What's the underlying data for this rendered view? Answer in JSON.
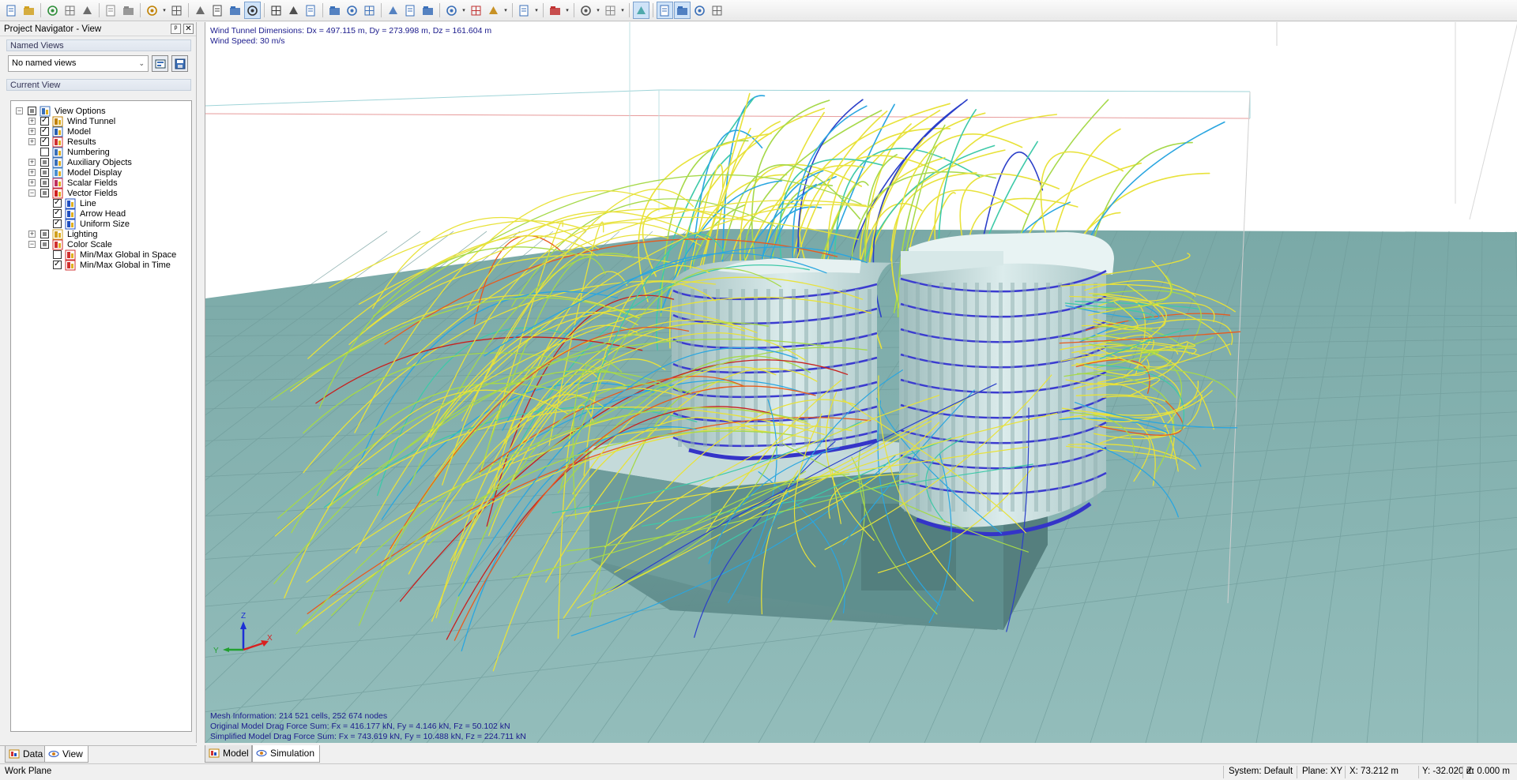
{
  "toolbar": {
    "icons": [
      "new-file-icon",
      "open-folder-icon",
      "save-icon",
      "print-preview-icon",
      "print-icon",
      "undo-icon",
      "redo-icon",
      "edit-menu-icon",
      "display-icon",
      "hide-icon",
      "grid-icon",
      "table-icon",
      "render-icon",
      "pan-icon",
      "rotate-icon",
      "fit-view-icon",
      "view-front-icon",
      "view-top-icon",
      "view-side-icon",
      "rotate-left-icon",
      "rotate-right-icon",
      "refresh-icon",
      "zoom-window-icon",
      "select-icon",
      "arrow-icon",
      "box-view-icon",
      "color-scale-icon",
      "section-icon",
      "wind-icon",
      "layers-icon",
      "panel-1-icon",
      "panel-2-icon",
      "panel-3-icon",
      "options-icon"
    ]
  },
  "navigator": {
    "title": "Project Navigator - View",
    "pin_label": "ᵖ",
    "close_label": "✕",
    "named_views_label": "Named Views",
    "named_views_value": "No named views",
    "current_view_label": "Current View",
    "tree": [
      {
        "label": "View Options",
        "level": 0,
        "expand": "minus",
        "check": "partial",
        "icon": "view-options-icon"
      },
      {
        "label": "Wind Tunnel",
        "level": 1,
        "expand": "plus",
        "check": "checked",
        "icon": "wind-tunnel-icon"
      },
      {
        "label": "Model",
        "level": 1,
        "expand": "plus",
        "check": "checked",
        "icon": "model-icon"
      },
      {
        "label": "Results",
        "level": 1,
        "expand": "plus",
        "check": "checked",
        "icon": "results-icon"
      },
      {
        "label": "Numbering",
        "level": 1,
        "expand": "none",
        "check": "unchecked",
        "icon": "numbering-icon"
      },
      {
        "label": "Auxiliary Objects",
        "level": 1,
        "expand": "plus",
        "check": "partial",
        "icon": "auxiliary-objects-icon"
      },
      {
        "label": "Model Display",
        "level": 1,
        "expand": "plus",
        "check": "partial",
        "icon": "model-display-icon"
      },
      {
        "label": "Scalar Fields",
        "level": 1,
        "expand": "plus",
        "check": "partial",
        "icon": "scalar-fields-icon"
      },
      {
        "label": "Vector Fields",
        "level": 1,
        "expand": "minus",
        "check": "partial",
        "icon": "vector-fields-icon"
      },
      {
        "label": "Line",
        "level": 2,
        "expand": "none",
        "check": "checked",
        "icon": "vector-line-icon"
      },
      {
        "label": "Arrow Head",
        "level": 2,
        "expand": "none",
        "check": "checked",
        "icon": "arrow-head-icon"
      },
      {
        "label": "Uniform Size",
        "level": 2,
        "expand": "none",
        "check": "checked",
        "icon": "uniform-size-icon"
      },
      {
        "label": "Lighting",
        "level": 1,
        "expand": "plus",
        "check": "partial",
        "icon": "lighting-icon"
      },
      {
        "label": "Color Scale",
        "level": 1,
        "expand": "minus",
        "check": "partial",
        "icon": "color-scale-icon"
      },
      {
        "label": "Min/Max Global in Space",
        "level": 2,
        "expand": "none",
        "check": "unchecked",
        "icon": "minmax-space-icon"
      },
      {
        "label": "Min/Max Global in Time",
        "level": 2,
        "expand": "none",
        "check": "checked",
        "icon": "minmax-time-icon"
      }
    ],
    "tabs": [
      {
        "label": "Data",
        "active": false
      },
      {
        "label": "View",
        "active": true
      }
    ]
  },
  "viewport": {
    "info_line1": "Wind Tunnel Dimensions: Dx = 497.115 m, Dy = 273.998 m, Dz = 161.604 m",
    "info_line2": "Wind Speed: 30 m/s",
    "mesh_info": "Mesh Information: 214 521 cells, 252 674 nodes",
    "original_drag": "Original Model Drag Force Sum: Fx = 416.177 kN, Fy = 4.146 kN, Fz = 50.102 kN",
    "simplified_drag": "Simplified Model Drag Force Sum: Fx = 743.619 kN, Fy = 10.488 kN, Fz = 224.711 kN",
    "axis_labels": {
      "z": "Z",
      "x": "X",
      "y": "Y"
    },
    "colors": {
      "ground": "#8ab5b3",
      "building": "#cfe3e3",
      "floor_bands": "#3b3bd0"
    },
    "streamline_palette": [
      "#e8e23a",
      "#a6d94a",
      "#3ec9a8",
      "#2aa6e0",
      "#2b3fc9",
      "#e85a1d",
      "#c8201e"
    ]
  },
  "view_tabs": [
    {
      "label": "Model",
      "active": false
    },
    {
      "label": "Simulation",
      "active": true
    }
  ],
  "status": {
    "left": "Work Plane",
    "system": "System: Default",
    "plane": "Plane: XY",
    "x": "X:  73.212 m",
    "y": "Y:  -32.020 m",
    "z": "Z:  0.000 m"
  }
}
